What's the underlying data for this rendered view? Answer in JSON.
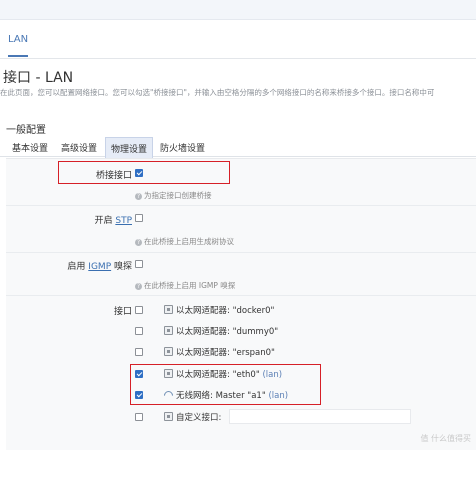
{
  "tabs": {
    "lan": "LAN"
  },
  "page": {
    "title": "接口 - LAN",
    "description": "在此页面，您可以配置网络接口。您可以勾选\"桥接接口\"，并输入由空格分隔的多个网络接口的名称来桥接多个接口。接口名称中可"
  },
  "section": {
    "title": "一般配置",
    "subtabs": [
      "基本设置",
      "高级设置",
      "物理设置",
      "防火墙设置"
    ]
  },
  "fields": {
    "bridge": {
      "label": "桥接接口",
      "hint": "为指定接口创建桥接",
      "checked": true
    },
    "stp": {
      "label_prefix": "开启 ",
      "label_link": "STP",
      "hint": "在此桥接上启用生成树协议",
      "checked": false
    },
    "igmp": {
      "label_prefix": "启用 ",
      "label_link": "IGMP",
      "label_suffix": " 嗅探",
      "hint": "在此桥接上启用 IGMP 嗅探",
      "checked": false
    },
    "interfaces_label": "接口"
  },
  "interfaces": [
    {
      "icon": "ethernet-adapter-icon",
      "text": "以太网适配器: \"docker0\"",
      "lan": "",
      "checked": false
    },
    {
      "icon": "ethernet-adapter-icon",
      "text": "以太网适配器: \"dummy0\"",
      "lan": "",
      "checked": false
    },
    {
      "icon": "ethernet-adapter-icon",
      "text": "以太网适配器: \"erspan0\"",
      "lan": "",
      "checked": false
    },
    {
      "icon": "ethernet-adapter-icon",
      "text": "以太网适配器: \"eth0\" ",
      "lan": "(lan)",
      "checked": true
    },
    {
      "icon": "wireless-network-icon",
      "text": "无线网络: Master \"a1\" ",
      "lan": "(lan)",
      "checked": true
    },
    {
      "icon": "ethernet-adapter-icon",
      "text": "自定义接口: ",
      "lan": "",
      "checked": false
    }
  ],
  "watermark": "值 什么值得买",
  "colors": {
    "accent": "#2f6fc4",
    "highlight": "#d62027",
    "link": "#3a6fb0"
  }
}
